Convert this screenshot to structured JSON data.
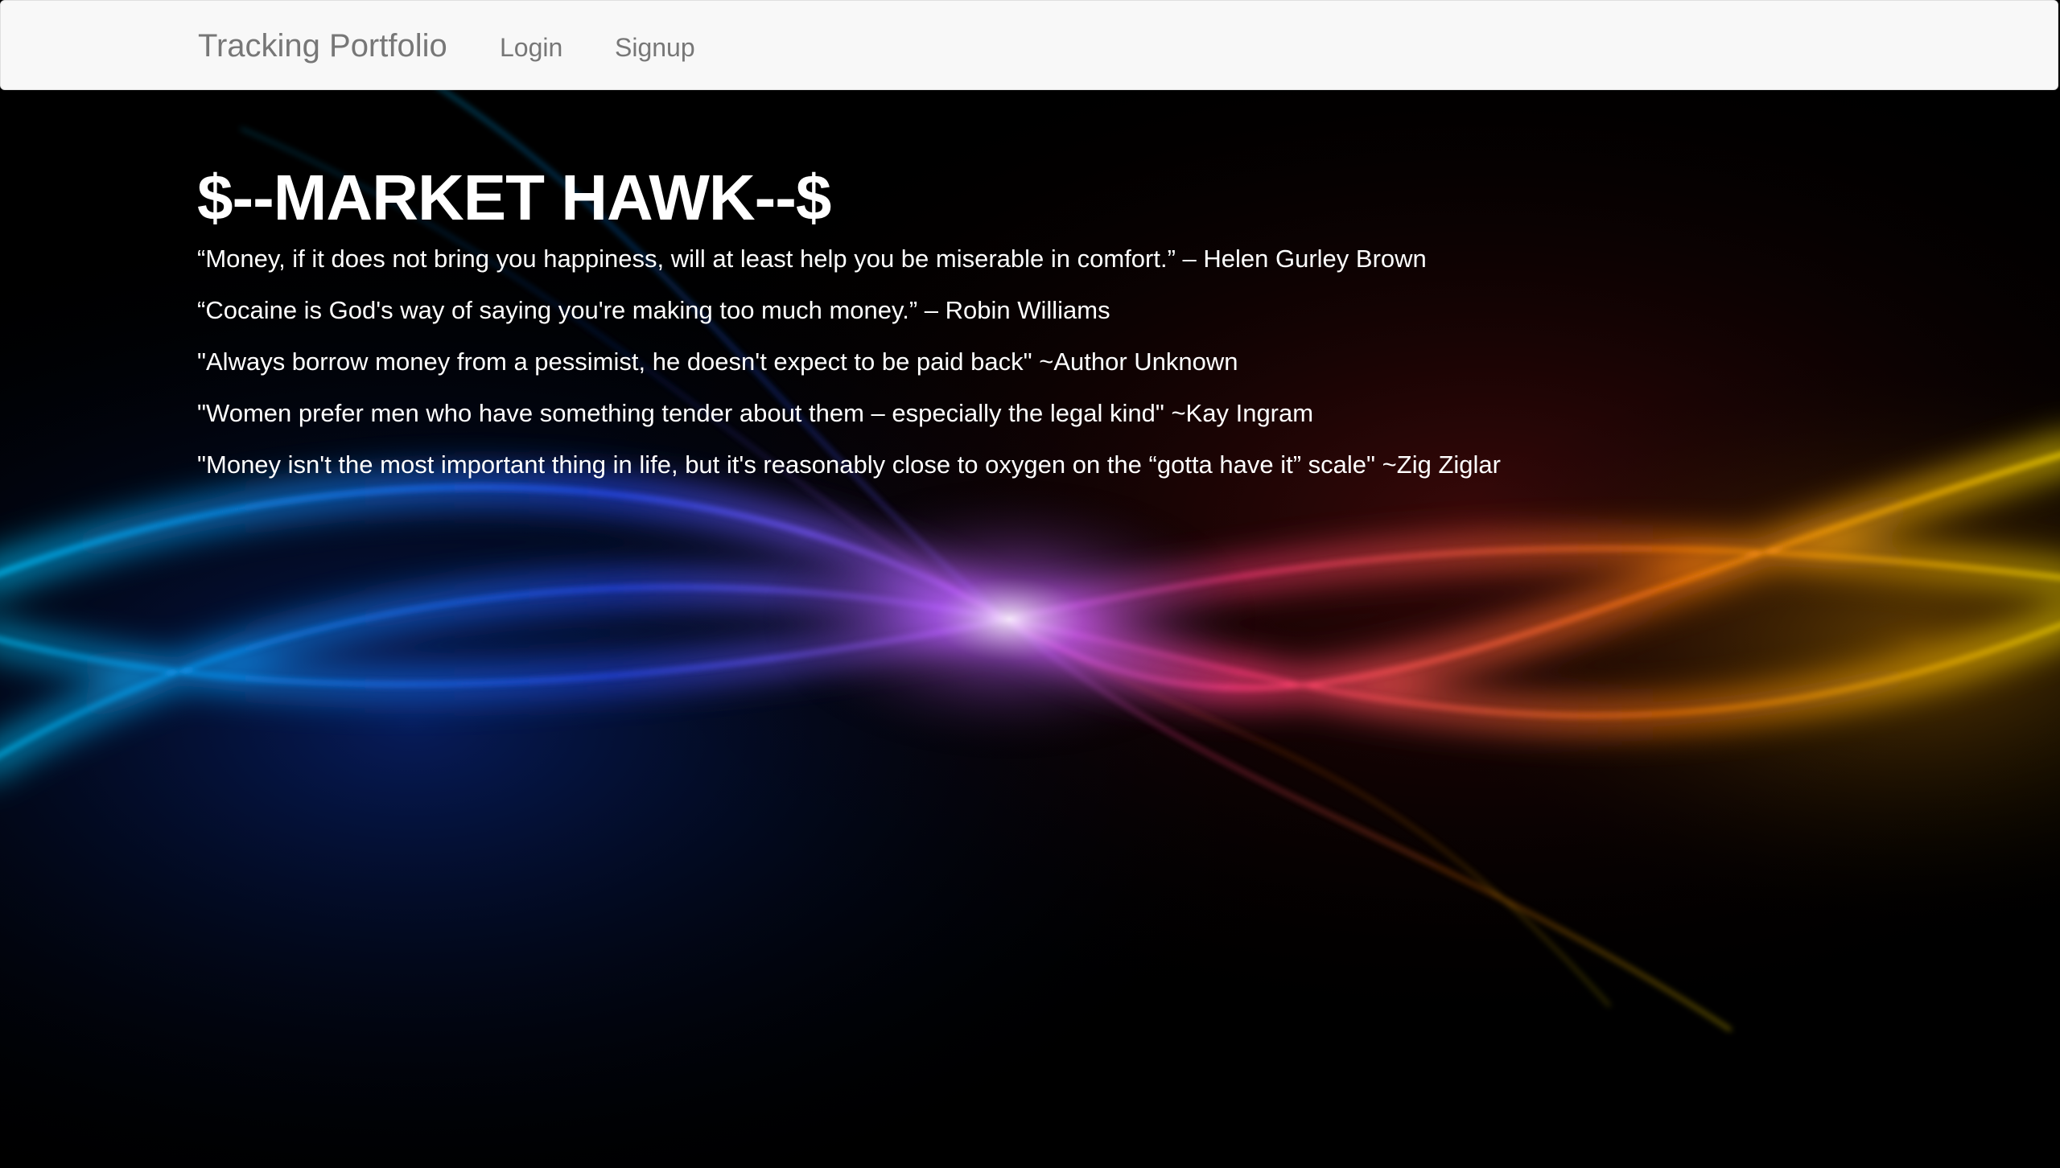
{
  "navbar": {
    "brand": "Tracking Portfolio",
    "links": [
      {
        "label": "Login"
      },
      {
        "label": "Signup"
      }
    ]
  },
  "hero": {
    "title": "$--MARKET HAWK--$",
    "quotes": [
      "“Money, if it does not bring you happiness, will at least help you be miserable in comfort.” – Helen Gurley Brown",
      "“Cocaine is God's way of saying you're making too much money.” – Robin Williams",
      "\"Always borrow money from a pessimist, he doesn't expect to be paid back\" ~Author Unknown",
      "\"Women prefer men who have something tender about them – especially the legal kind\" ~Kay Ingram",
      "\"Money isn't the most important thing in life, but it's reasonably close to oxygen on the “gotta have it” scale\" ~Zig Ziglar"
    ]
  },
  "colors": {
    "navbar_bg": "#f8f8f8",
    "nav_text": "#777777",
    "hero_text": "#ffffff",
    "page_bg": "#000000"
  }
}
